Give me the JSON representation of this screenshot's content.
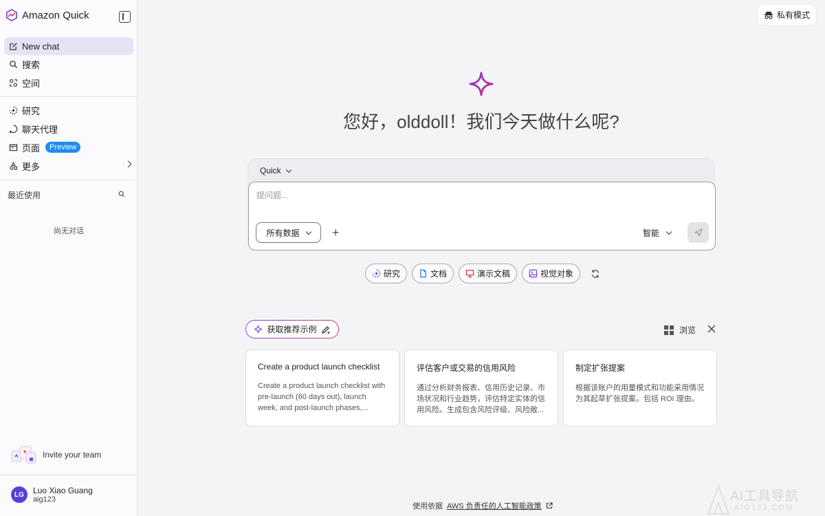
{
  "sidebar": {
    "brand": "Amazon Quick",
    "nav_primary": [
      {
        "label": "New chat",
        "icon": "edit-icon"
      },
      {
        "label": "搜索",
        "icon": "search-icon"
      },
      {
        "label": "空间",
        "icon": "spaces-icon"
      }
    ],
    "nav_secondary": [
      {
        "label": "研究",
        "icon": "research-icon"
      },
      {
        "label": "聊天代理",
        "icon": "chat-agent-icon"
      },
      {
        "label": "页面",
        "icon": "page-icon",
        "badge": "Preview"
      },
      {
        "label": "更多",
        "icon": "more-icon"
      }
    ],
    "recent_title": "最近使用",
    "empty_text": "尚无对话",
    "invite": "Invite your team",
    "user": {
      "initials": "LG",
      "name": "Luo Xiao Guang",
      "sub": "aig123"
    }
  },
  "header": {
    "private_mode": "私有模式"
  },
  "main": {
    "greeting": "您好，olddoll！我们今天做什么呢?",
    "model": "Quick",
    "placeholder": "提问题...",
    "data_scope": "所有数据",
    "mode": "智能",
    "chips": [
      "研究",
      "文档",
      "演示文稿",
      "视觉对象"
    ],
    "suggest_label": "获取推荐示例",
    "browse_label": "浏览",
    "cards": [
      {
        "title": "Create a product launch checklist",
        "desc": "Create a product launch checklist with pre-launch (60 days out), launch week, and post-launch phases,..."
      },
      {
        "title": "评估客户或交易的信用风险",
        "desc": "通过分析财务报表、信用历史记录、市场状况和行业趋势，评估特定实体的信用风险。生成包含风险评级、风险敞..."
      },
      {
        "title": "制定扩张提案",
        "desc": "根据该账户的用量模式和功能采用情况为其起草扩张提案。包括 ROI 理由。"
      }
    ],
    "footer_prefix": "使用依据",
    "footer_link": "AWS 负责任的人工智能政策"
  },
  "watermark": {
    "text": "AI工具导航",
    "sub": "AIG123.COM"
  },
  "colors": {
    "accent": "#5a3fd6",
    "active_nav": "#e6e3f7",
    "preview_badge": "#1d8cf0"
  }
}
